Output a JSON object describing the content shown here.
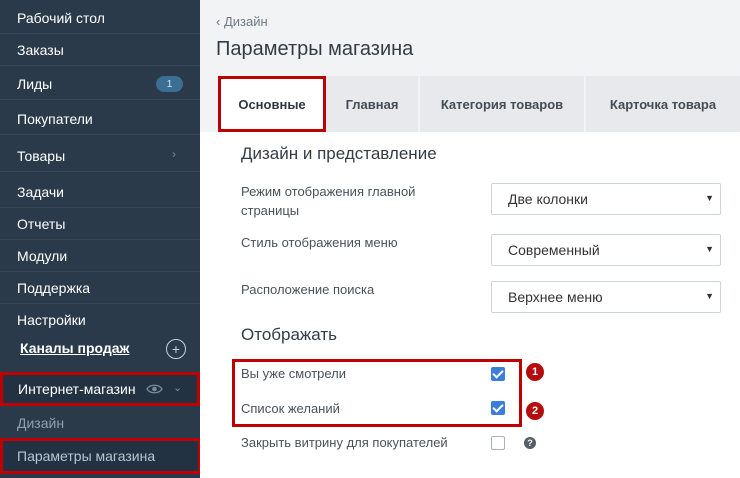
{
  "sidebar": {
    "items": [
      {
        "label": "Рабочий стол"
      },
      {
        "label": "Заказы"
      },
      {
        "label": "Лиды",
        "badge": "1"
      },
      {
        "label": "Покупатели"
      },
      {
        "label": "Товары"
      },
      {
        "label": "Задачи"
      },
      {
        "label": "Отчеты"
      },
      {
        "label": "Модули"
      },
      {
        "label": "Поддержка"
      },
      {
        "label": "Настройки"
      }
    ],
    "channels_label": "Каналы продаж",
    "shop_label": "Интернет-магазин",
    "sub_design": "Дизайн",
    "sub_params": "Параметры магазина"
  },
  "header": {
    "breadcrumb": "Дизайн",
    "title": "Параметры магазина"
  },
  "tabs": [
    {
      "label": "Основные",
      "active": true
    },
    {
      "label": "Главная"
    },
    {
      "label": "Категория товаров"
    },
    {
      "label": "Карточка товара"
    }
  ],
  "design": {
    "title": "Дизайн и представление",
    "fields": [
      {
        "label": "Режим отображения главной страницы",
        "value": "Две колонки"
      },
      {
        "label": "Стиль отображения меню",
        "value": "Современный"
      },
      {
        "label": "Расположение поиска",
        "value": "Верхнее меню"
      }
    ]
  },
  "display": {
    "title": "Отображать",
    "options": [
      {
        "label": "Вы уже смотрели",
        "checked": true,
        "marker": "1"
      },
      {
        "label": "Список желаний",
        "checked": true,
        "marker": "2"
      },
      {
        "label": "Закрыть витрину для покупателей",
        "checked": false,
        "help": "?"
      }
    ]
  },
  "colors": {
    "sidebar_bg": "#2b3a4a",
    "highlight": "#c00000",
    "checkbox_on": "#3b7dd8",
    "badge": "#3b6e93"
  }
}
